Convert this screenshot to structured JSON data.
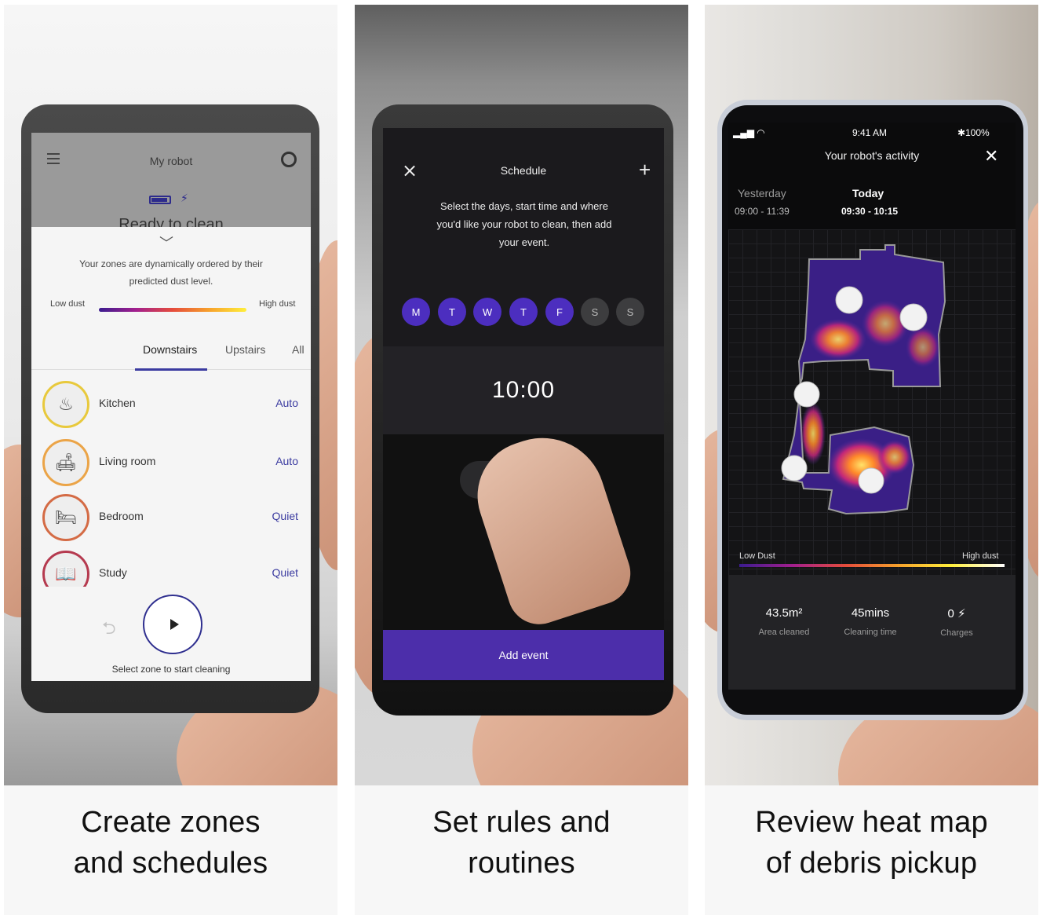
{
  "panels": [
    {
      "caption": [
        "Create zones",
        "and schedules"
      ],
      "screen": {
        "title": "My robot",
        "status": "Ready to clean",
        "description": "Your zones are dynamically ordered by their predicted dust level.",
        "low_dust": "Low dust",
        "high_dust": "High dust",
        "tabs": [
          "Downstairs",
          "Upstairs",
          "All"
        ],
        "zones": [
          {
            "name": "Kitchen",
            "mode": "Auto",
            "ring": "#e8c93c"
          },
          {
            "name": "Living room",
            "mode": "Auto",
            "ring": "#eba447"
          },
          {
            "name": "Bedroom",
            "mode": "Quiet",
            "ring": "#d46b45"
          },
          {
            "name": "Study",
            "mode": "Quiet",
            "ring": "#b53a4f"
          }
        ],
        "hint": "Select zone to start cleaning"
      }
    },
    {
      "caption": [
        "Set rules and",
        "routines"
      ],
      "screen": {
        "title": "Schedule",
        "description": "Select the days, start time and where you'd like your robot to clean, then add your event.",
        "days": [
          {
            "label": "M",
            "on": true
          },
          {
            "label": "T",
            "on": true
          },
          {
            "label": "W",
            "on": true
          },
          {
            "label": "T",
            "on": true
          },
          {
            "label": "F",
            "on": true
          },
          {
            "label": "S",
            "on": false
          },
          {
            "label": "S",
            "on": false
          }
        ],
        "time": "10:00",
        "add_event": "Add event"
      }
    },
    {
      "caption": [
        "Review heat map",
        "of debris pickup"
      ],
      "screen": {
        "clock": "9:41 AM",
        "battery": "100%",
        "title": "Your robot's activity",
        "yesterday_label": "Yesterday",
        "yesterday_time": "09:00 - 11:39",
        "today_label": "Today",
        "today_time": "09:30 - 10:15",
        "low_dust": "Low Dust",
        "high_dust": "High dust",
        "stats": [
          {
            "value": "43.5m²",
            "label": "Area cleaned"
          },
          {
            "value": "45mins",
            "label": "Cleaning time"
          },
          {
            "value": "0",
            "label": "Charges"
          }
        ]
      }
    }
  ]
}
